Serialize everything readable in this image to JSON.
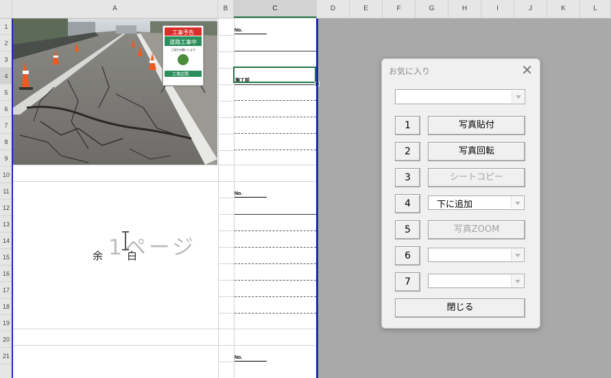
{
  "columns": [
    "A",
    "B",
    "C",
    "D",
    "E",
    "F",
    "G",
    "H",
    "I",
    "J",
    "K",
    "L"
  ],
  "rows": [
    "1",
    "2",
    "3",
    "4",
    "5",
    "6",
    "7",
    "8",
    "9",
    "10",
    "11",
    "12",
    "13",
    "14",
    "15",
    "16",
    "17",
    "18",
    "19",
    "20",
    "21"
  ],
  "sheet": {
    "no_label": "No.",
    "builder_label": "施工前",
    "yohaku_1": "余",
    "yohaku_2": "白",
    "page_watermark": "1ページ"
  },
  "photo": {
    "sign_line1": "工事予告",
    "sign_line2": "道路工事中",
    "sign_line3": "ご協力お願いします",
    "sign_line4": "工事区間"
  },
  "dialog": {
    "title": "お気に入り",
    "close": "✕",
    "buttons": [
      {
        "num": "1",
        "label": "写真貼付",
        "enabled": true
      },
      {
        "num": "2",
        "label": "写真回転",
        "enabled": true
      },
      {
        "num": "3",
        "label": "シートコピー",
        "enabled": false
      },
      {
        "num": "4",
        "label": "下に追加",
        "type": "combo"
      },
      {
        "num": "5",
        "label": "写真ZOOM",
        "enabled": false
      },
      {
        "num": "6",
        "label": "",
        "type": "combo"
      },
      {
        "num": "7",
        "label": "",
        "type": "combo"
      }
    ],
    "close_button": "閉じる"
  }
}
